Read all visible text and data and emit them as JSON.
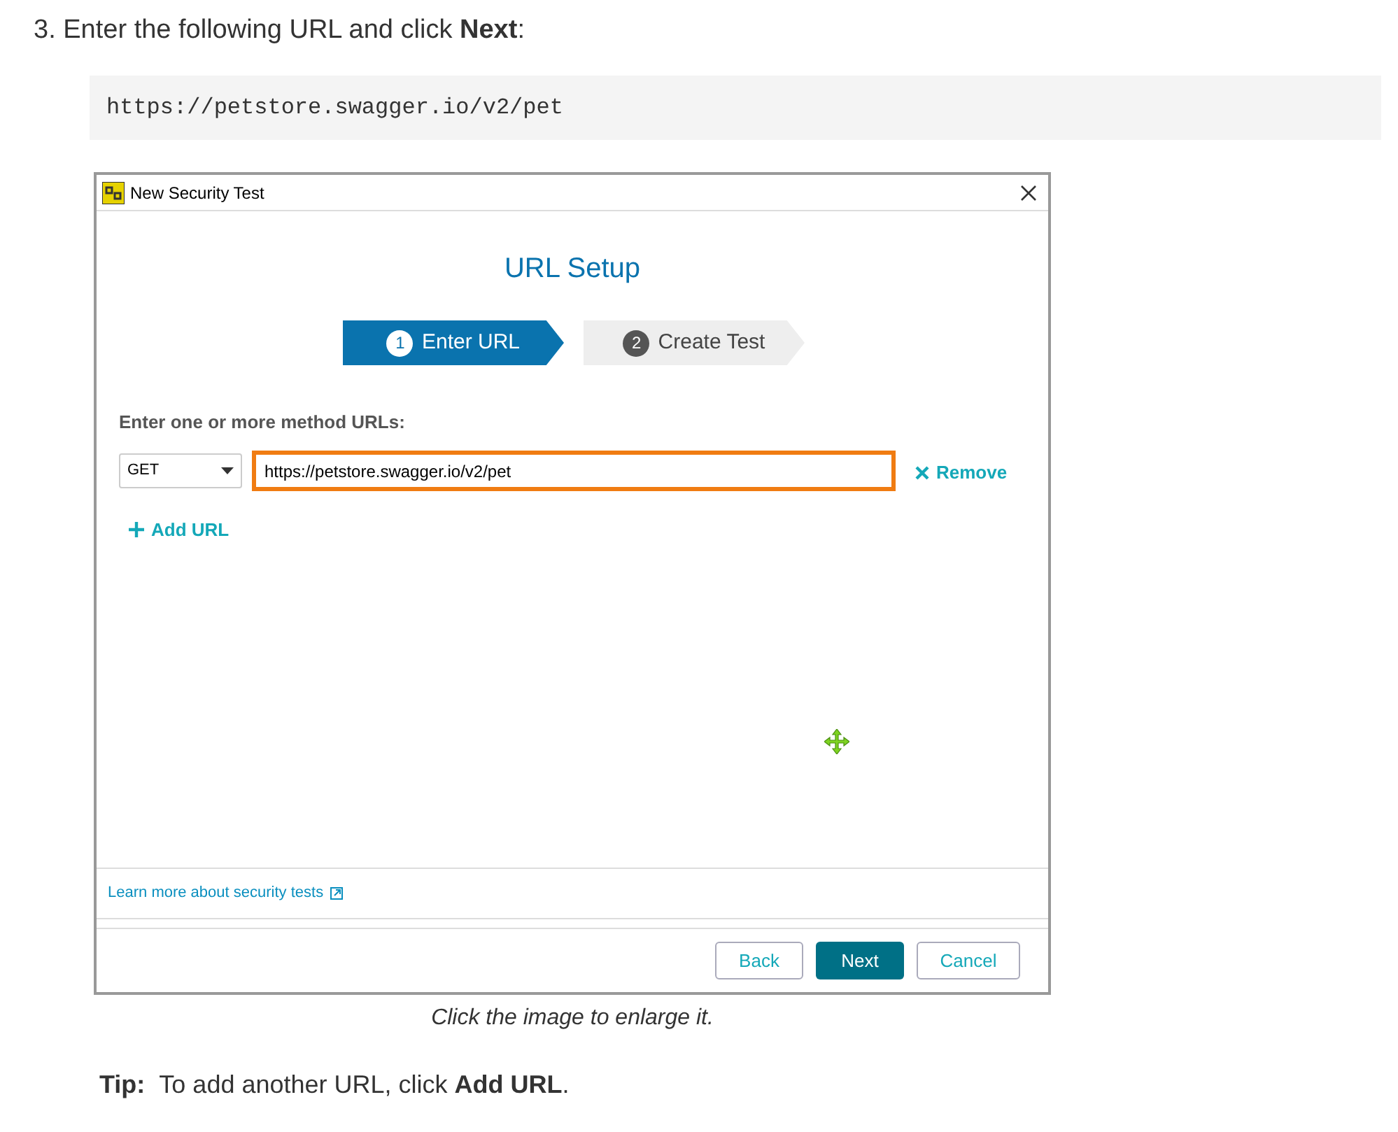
{
  "step_text": "3. Enter the following URL and click **Next**:",
  "code": "https://petstore.swagger.io/v2/pet",
  "dialog": {
    "title": "New Security Test",
    "heading": "URL Setup",
    "steps": [
      {
        "number": "1",
        "label": "Enter URL",
        "selected": true
      },
      {
        "number": "2",
        "label": "Create Test",
        "selected": false
      }
    ],
    "prompt": "Enter one or more method URLs:",
    "method": "GET",
    "url_value": "https://petstore.swagger.io/v2/pet",
    "remove": "Remove",
    "add_url": "Add URL",
    "learn_link": "Learn more about security tests",
    "buttons": [
      {
        "label": "Back",
        "kind": "secondary"
      },
      {
        "label": "Next",
        "kind": "primary"
      },
      {
        "label": "Cancel",
        "kind": "secondary"
      }
    ]
  },
  "caption": "Click the image to enlarge it.",
  "tip_label": "Tip:",
  "tip_text": "To add another URL, click **Add URL**."
}
